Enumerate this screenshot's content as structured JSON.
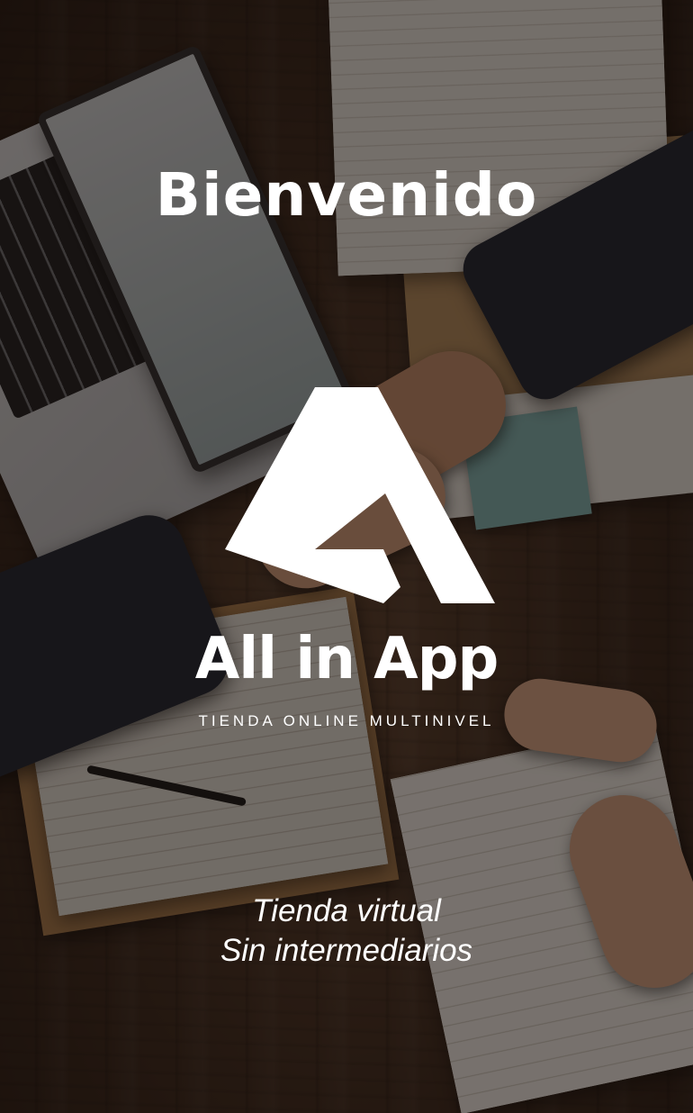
{
  "screen": {
    "title": "Bienvenido"
  },
  "brand": {
    "name": "All in App",
    "tagline": "TIENDA ONLINE MULTINIVEL",
    "logo_icon": "triangle-a-logo-icon",
    "logo_color": "#ffffff"
  },
  "slogan": {
    "line1": "Tienda virtual",
    "line2": "Sin intermediarios"
  },
  "colors": {
    "text": "#ffffff",
    "overlay": "#140d09"
  }
}
